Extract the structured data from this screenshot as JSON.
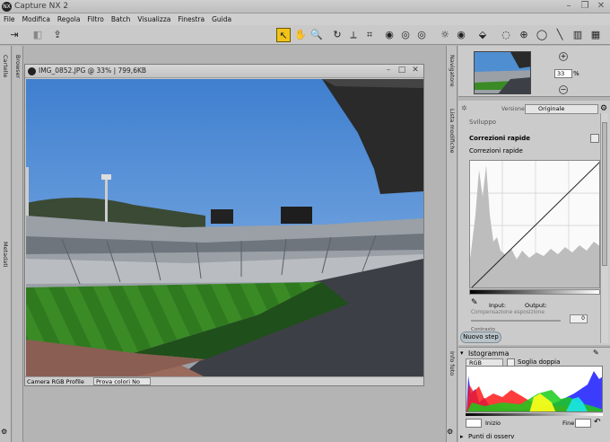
{
  "app": {
    "title": "Capture NX 2"
  },
  "menu": [
    "File",
    "Modifica",
    "Regola",
    "Filtro",
    "Batch",
    "Visualizza",
    "Finestra",
    "Guida"
  ],
  "document": {
    "title": "IMG_0852.JPG @ 33% | 799,6KB",
    "color_profile": "Camera RGB Profile",
    "proof_colors": "Prova colori No"
  },
  "left_panels": [
    "Cartelle",
    "Browser",
    "Metadati"
  ],
  "right_panels": [
    "Navigatore",
    "Lista modifiche",
    "Info foto"
  ],
  "navigator": {
    "zoom": "33",
    "unit": "%"
  },
  "edit_list": {
    "version_label": "Versione",
    "version_value": "Originale",
    "develop": "Sviluppo",
    "quick_fix": "Correzioni rapide",
    "quick_fix_sub": "Correzioni rapide",
    "input_label": "Input:",
    "output_label": "Output:",
    "exposure_comp": "Compensazione esposizione",
    "exposure_value": "0",
    "contrast": "Contrasto",
    "new_step": "Nuovo step"
  },
  "histogram": {
    "title": "Istogramma",
    "channel": "RGB",
    "double_threshold": "Soglia doppia",
    "start_label": "Inizio",
    "end_label": "Fine",
    "watch_points": "Punti di osserv"
  },
  "colors": {
    "active_tool": "#f1c31a",
    "sky": "#4f8ed0",
    "grass": "#3e8a28"
  }
}
